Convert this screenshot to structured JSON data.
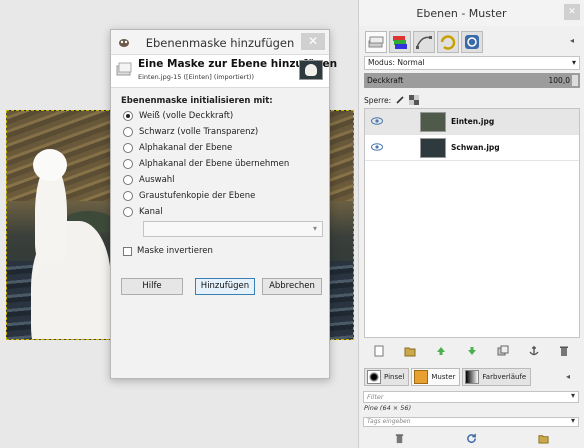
{
  "dialog": {
    "title": "Ebenenmaske hinzufügen",
    "heading": "Eine Maske zur Ebene hinzufügen",
    "subheading": "Einten.jpg-15 ([Einten] (importiert))",
    "section_label": "Ebenenmaske initialisieren mit:",
    "options": [
      {
        "label": "Weiß (volle Deckkraft)",
        "checked": true
      },
      {
        "label": "Schwarz (volle Transparenz)",
        "checked": false
      },
      {
        "label": "Alphakanal der Ebene",
        "checked": false
      },
      {
        "label": "Alphakanal der Ebene übernehmen",
        "checked": false
      },
      {
        "label": "Auswahl",
        "checked": false
      },
      {
        "label": "Graustufenkopie der Ebene",
        "checked": false
      },
      {
        "label": "Kanal",
        "checked": false
      }
    ],
    "invert_label": "Maske invertieren",
    "help_label": "Hilfe",
    "add_label": "Hinzufügen",
    "cancel_label": "Abbrechen"
  },
  "panel": {
    "title": "Ebenen - Muster",
    "mode_label": "Modus: Normal",
    "opacity_label": "Deckkraft",
    "opacity_value": "100,0",
    "lock_label": "Sperre:",
    "layers": [
      {
        "name": "Einten.jpg",
        "selected": true
      },
      {
        "name": "Schwan.jpg",
        "selected": false
      }
    ],
    "bottom_tabs": [
      "Pinsel",
      "Muster",
      "Farbverläufe"
    ],
    "filter_placeholder": "Filter",
    "pattern_info": "Pine (64 × 56)",
    "tags_placeholder": "Tags eingeben"
  },
  "colors": {
    "accent": "#3c7fb1",
    "selection": "#c8b000"
  }
}
